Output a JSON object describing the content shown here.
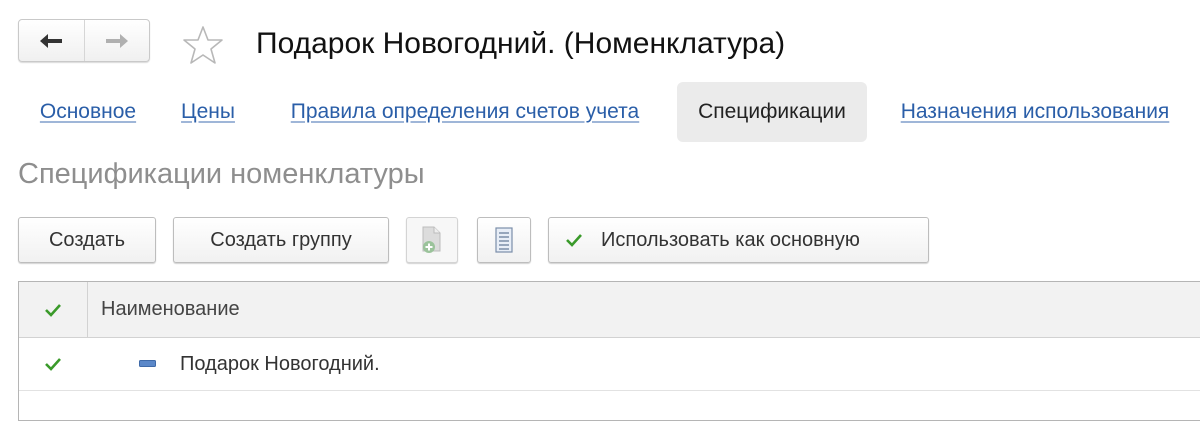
{
  "window": {
    "title": "Подарок Новогодний. (Номенклатура)"
  },
  "nav": {
    "back_icon": "arrow-left-icon",
    "forward_icon": "arrow-right-icon",
    "favorite_icon": "star-icon"
  },
  "tabs": [
    {
      "label": "Основное",
      "active": false
    },
    {
      "label": "Цены",
      "active": false
    },
    {
      "label": "Правила определения счетов учета",
      "active": false
    },
    {
      "label": "Спецификации",
      "active": true
    },
    {
      "label": "Назначения использования",
      "active": false
    }
  ],
  "section": {
    "title": "Спецификации номенклатуры"
  },
  "toolbar": {
    "create_label": "Создать",
    "create_group_label": "Создать группу",
    "copy_icon": "add-copy-icon",
    "list_icon": "list-icon",
    "use_main_label": "Использовать как основную",
    "use_main_icon": "checkmark-icon"
  },
  "table": {
    "columns": [
      "Наименование"
    ],
    "rows": [
      {
        "name": "Подарок Новогодний.",
        "is_main": true
      }
    ]
  },
  "colors": {
    "link": "#2a5ea8",
    "check": "#3a9a2a",
    "item_icon": "#5b88c9"
  }
}
